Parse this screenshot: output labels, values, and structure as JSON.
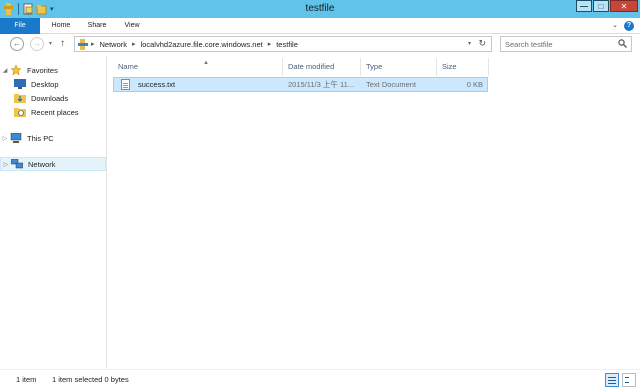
{
  "window": {
    "title": "testfile",
    "controls": {
      "minimize": "—",
      "maximize": "□",
      "close": "✕"
    }
  },
  "ribbon": {
    "tabs": [
      "File",
      "Home",
      "Share",
      "View"
    ],
    "help_icon": "help-icon"
  },
  "navigation": {
    "back_icon": "back-arrow-icon",
    "forward_icon": "forward-arrow-icon",
    "up_icon": "up-arrow-icon",
    "breadcrumb": [
      "Network",
      "localvhd2azure.file.core.windows.net",
      "testfile"
    ],
    "search_placeholder": "Search testfile"
  },
  "sidebar": {
    "items": [
      {
        "label": "Favorites",
        "icon": "star-icon"
      },
      {
        "label": "Desktop",
        "icon": "desktop-icon"
      },
      {
        "label": "Downloads",
        "icon": "downloads-folder-icon"
      },
      {
        "label": "Recent places",
        "icon": "recent-places-icon"
      },
      {
        "label": "This PC",
        "icon": "computer-icon"
      },
      {
        "label": "Network",
        "icon": "network-icon"
      }
    ]
  },
  "file_list": {
    "columns": [
      "Name",
      "Date modified",
      "Type",
      "Size"
    ],
    "rows": [
      {
        "name": "success.txt",
        "date": "2015/11/3 上午 11...",
        "type": "Text Document",
        "size": "0 KB"
      }
    ]
  },
  "status": {
    "item_count": "1 item",
    "selection": "1 item selected 0 bytes"
  },
  "colors": {
    "title_bar": "#5fc3ea",
    "file_tab": "#1979ca",
    "selection": "#cce8ff"
  }
}
